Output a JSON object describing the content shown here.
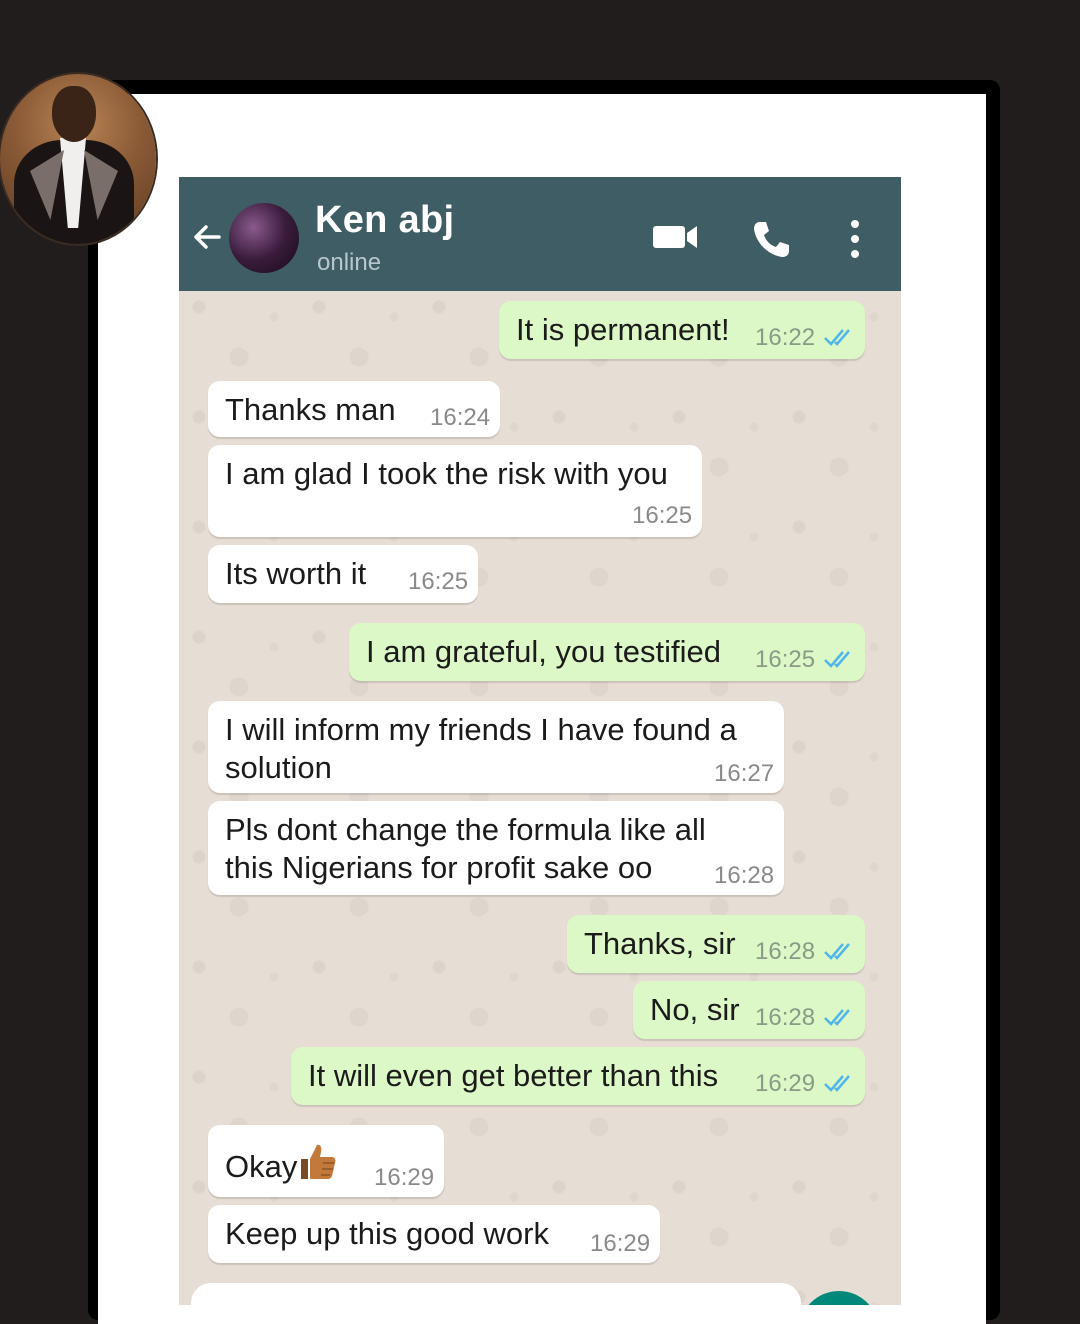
{
  "chat": {
    "contact_name": "Ken abj",
    "status": "online"
  },
  "header_icons": [
    "back-arrow-icon",
    "avatar",
    "video-call-icon",
    "phone-call-icon",
    "more-vert-icon"
  ],
  "colors": {
    "header": "#3f5d65",
    "outgoing_bubble": "#dcf8c6",
    "incoming_bubble": "#ffffff",
    "read_tick": "#4fb6ec",
    "chat_background": "#e6ded4"
  },
  "messages": [
    {
      "dir": "out",
      "text": "It is permanent!",
      "time": "16:22",
      "read": true
    },
    {
      "dir": "in",
      "text": "Thanks man",
      "time": "16:24"
    },
    {
      "dir": "in",
      "text": "I am glad I took the risk with you",
      "time": "16:25"
    },
    {
      "dir": "in",
      "text": "Its worth it",
      "time": "16:25"
    },
    {
      "dir": "out",
      "text": "I am grateful, you testified",
      "time": "16:25",
      "read": true
    },
    {
      "dir": "in",
      "text": "I will inform my friends I have found a\nsolution",
      "time": "16:27"
    },
    {
      "dir": "in",
      "text": "Pls dont change the formula like all\nthis Nigerians for profit sake oo",
      "time": "16:28"
    },
    {
      "dir": "out",
      "text": "Thanks, sir",
      "time": "16:28",
      "read": true
    },
    {
      "dir": "out",
      "text": "No, sir",
      "time": "16:28",
      "read": true
    },
    {
      "dir": "out",
      "text": "It will even get better than this",
      "time": "16:29",
      "read": true
    },
    {
      "dir": "in",
      "text": "Okay",
      "emoji": "thumbs-up-icon",
      "time": "16:29"
    },
    {
      "dir": "in",
      "text": "Keep up this good work",
      "time": "16:29"
    }
  ]
}
